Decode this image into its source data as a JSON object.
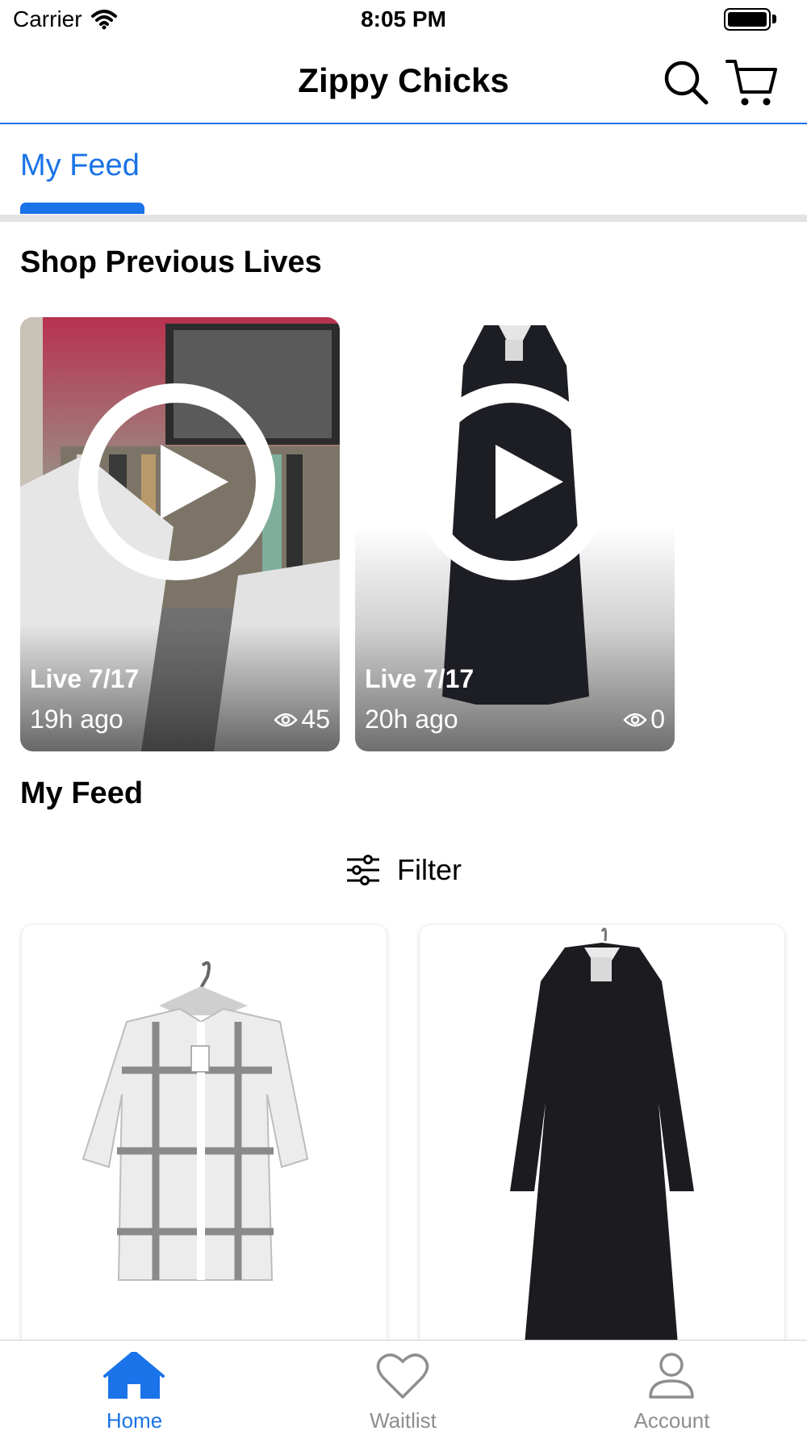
{
  "status_bar": {
    "carrier": "Carrier",
    "time": "8:05 PM"
  },
  "nav": {
    "title": "Zippy Chicks",
    "search_icon": "search-icon",
    "cart_icon": "cart-icon"
  },
  "tabs": [
    {
      "label": "My Feed",
      "active": true
    }
  ],
  "previous_lives": {
    "title": "Shop Previous Lives",
    "items": [
      {
        "label": "Live 7/17",
        "age": "19h ago",
        "views": "45"
      },
      {
        "label": "Live 7/17",
        "age": "20h ago",
        "views": "0"
      }
    ]
  },
  "feed": {
    "title": "My Feed",
    "filter_label": "Filter",
    "items": [
      {
        "image": "white-gray-plaid-blouse"
      },
      {
        "image": "black-long-shirt-dress"
      }
    ]
  },
  "tab_bar": {
    "items": [
      {
        "label": "Home",
        "icon": "home-icon",
        "active": true
      },
      {
        "label": "Waitlist",
        "icon": "heart-icon",
        "active": false
      },
      {
        "label": "Account",
        "icon": "account-icon",
        "active": false
      }
    ]
  },
  "colors": {
    "accent": "#1a73e8",
    "divider": "#e3e3e3",
    "inactive": "#8e8e8e"
  }
}
